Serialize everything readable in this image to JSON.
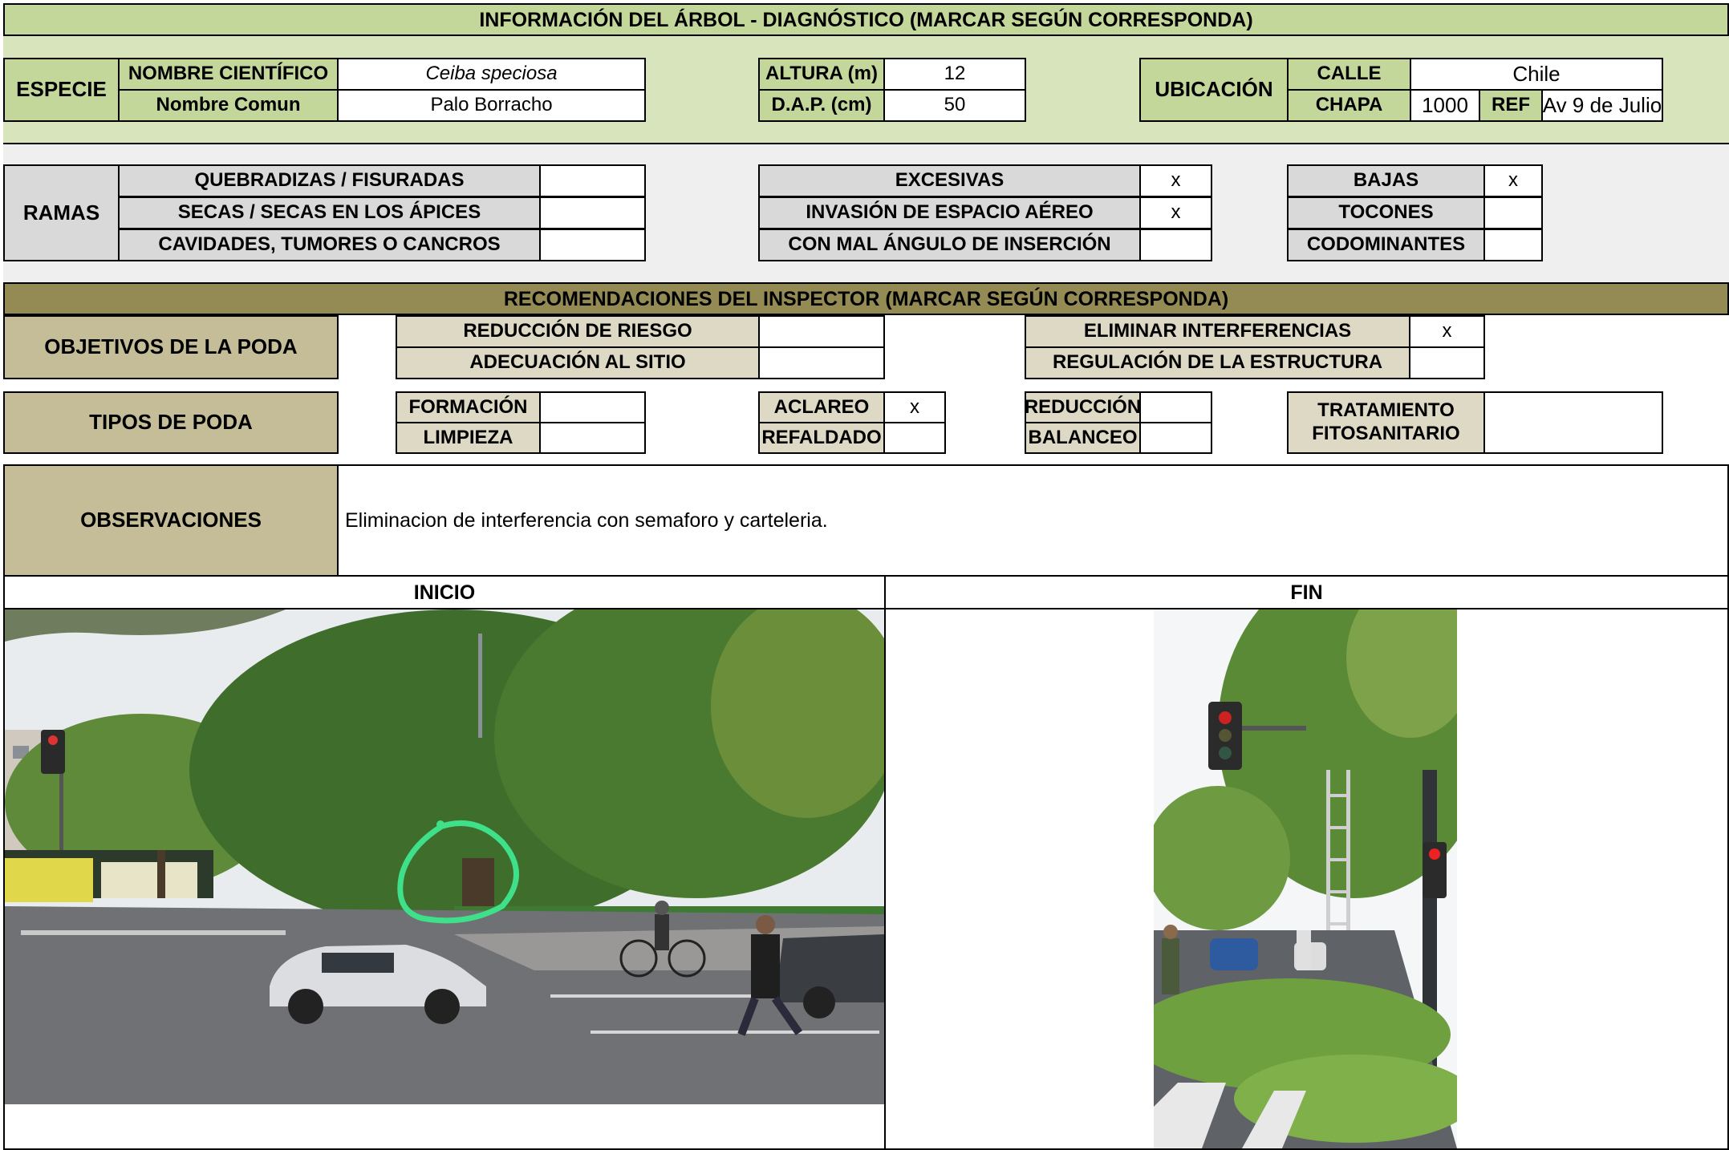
{
  "header": {
    "title": "INFORMACIÓN DEL ÁRBOL - DIAGNÓSTICO (MARCAR SEGÚN CORRESPONDA)"
  },
  "especie": {
    "label": "ESPECIE",
    "nombre_cientifico_label": "NOMBRE CIENTÍFICO",
    "nombre_cientifico_value": "Ceiba speciosa",
    "nombre_comun_label": "Nombre Comun",
    "nombre_comun_value": "Palo Borracho"
  },
  "medidas": {
    "altura_label": "ALTURA (m)",
    "altura_value": "12",
    "dap_label": "D.A.P. (cm)",
    "dap_value": "50"
  },
  "ubicacion": {
    "label": "UBICACIÓN",
    "calle_label": "CALLE",
    "calle_value": "Chile",
    "chapa_label": "CHAPA",
    "chapa_value": "1000",
    "ref_label": "REF",
    "ref_value": "Av 9 de Julio"
  },
  "ramas": {
    "label": "RAMAS",
    "col1": [
      {
        "label": "QUEBRADIZAS / FISURADAS",
        "value": ""
      },
      {
        "label": "SECAS / SECAS EN LOS ÁPICES",
        "value": ""
      },
      {
        "label": "CAVIDADES, TUMORES O CANCROS",
        "value": ""
      }
    ],
    "col2": [
      {
        "label": "EXCESIVAS",
        "value": "x"
      },
      {
        "label": "INVASIÓN DE ESPACIO AÉREO",
        "value": "x"
      },
      {
        "label": "CON MAL ÁNGULO DE INSERCIÓN",
        "value": ""
      }
    ],
    "col3": [
      {
        "label": "BAJAS",
        "value": "x"
      },
      {
        "label": "TOCONES",
        "value": ""
      },
      {
        "label": "CODOMINANTES",
        "value": ""
      }
    ]
  },
  "recomendaciones": {
    "title": "RECOMENDACIONES DEL INSPECTOR  (MARCAR SEGÚN CORRESPONDA)",
    "objetivos_label": "OBJETIVOS DE LA PODA",
    "objetivos": [
      {
        "label": "REDUCCIÓN DE RIESGO",
        "value": ""
      },
      {
        "label": "ADECUACIÓN AL SITIO",
        "value": ""
      },
      {
        "label": "ELIMINAR INTERFERENCIAS",
        "value": "x"
      },
      {
        "label": "REGULACIÓN DE LA ESTRUCTURA",
        "value": ""
      }
    ],
    "tipos_label": "TIPOS DE PODA",
    "tipos": [
      {
        "label": "FORMACIÓN",
        "value": ""
      },
      {
        "label": "LIMPIEZA",
        "value": ""
      },
      {
        "label": "ACLAREO",
        "value": "x"
      },
      {
        "label": "REFALDADO",
        "value": ""
      },
      {
        "label": "REDUCCIÓN",
        "value": ""
      },
      {
        "label": "BALANCEO",
        "value": ""
      }
    ],
    "tratamiento_label_1": "TRATAMIENTO",
    "tratamiento_label_2": "FITOSANITARIO",
    "tratamiento_value": ""
  },
  "observaciones": {
    "label": "OBSERVACIONES",
    "text": "Eliminacion de interferencia con semaforo y carteleria."
  },
  "fotos": {
    "inicio_label": "INICIO",
    "fin_label": "FIN"
  }
}
